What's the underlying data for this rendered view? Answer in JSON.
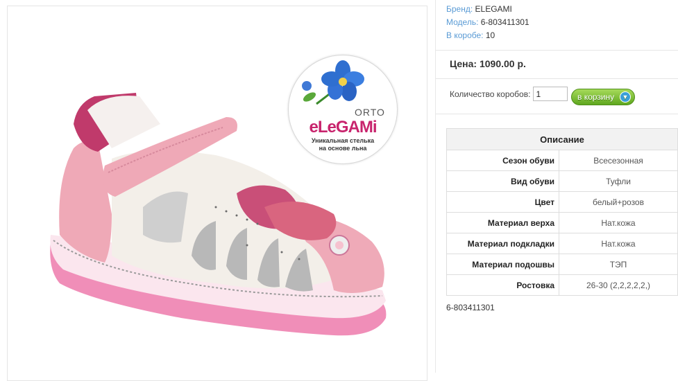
{
  "meta": {
    "brand_label": "Бренд:",
    "brand_value": "ELEGAMI",
    "model_label": "Модель:",
    "model_value": "6-803411301",
    "box_label": "В коробе:",
    "box_value": "10"
  },
  "price": "Цена: 1090.00 р.",
  "quantity": {
    "label": "Количество коробов:",
    "value": "1"
  },
  "cart_button": "в корзину",
  "spec": {
    "title": "Описание",
    "rows": [
      {
        "label": "Сезон обуви",
        "value": "Всесезонная"
      },
      {
        "label": "Вид обуви",
        "value": "Туфли"
      },
      {
        "label": "Цвет",
        "value": "белый+розов"
      },
      {
        "label": "Материал верха",
        "value": "Нат.кожа"
      },
      {
        "label": "Материал подкладки",
        "value": "Нат.кожа"
      },
      {
        "label": "Материал подошвы",
        "value": "ТЭП"
      },
      {
        "label": "Ростовка",
        "value": "26-30 (2,2,2,2,2,)"
      }
    ]
  },
  "product_code": "6-803411301",
  "logo": {
    "orto": "ORTO",
    "brand": "eLeGAMi",
    "tagline_1": "Уникальная стелька",
    "tagline_2": "на основе льна"
  },
  "colors": {
    "link": "#5a9bd5",
    "brand_pink": "#c8246d",
    "button_green": "#6db22b"
  }
}
